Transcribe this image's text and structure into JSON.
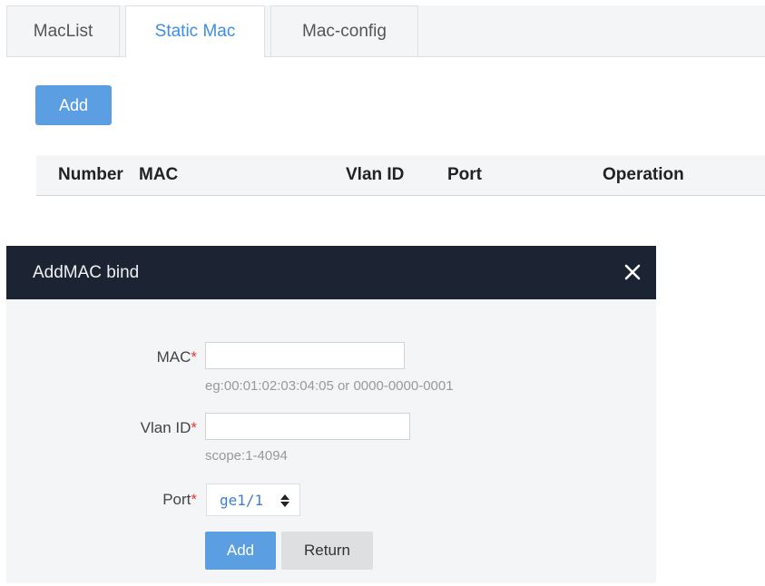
{
  "tabs": [
    {
      "label": "MacList",
      "active": false
    },
    {
      "label": "Static Mac",
      "active": true
    },
    {
      "label": "Mac-config",
      "active": false
    }
  ],
  "toolbar": {
    "add_label": "Add"
  },
  "table": {
    "columns": [
      "Number",
      "MAC",
      "Vlan ID",
      "Port",
      "Operation"
    ]
  },
  "dialog": {
    "title": "AddMAC bind",
    "close_icon": "close-icon",
    "fields": {
      "mac": {
        "label": "MAC",
        "required_mark": "*",
        "value": "",
        "hint": "eg:00:01:02:03:04:05 or 0000-0000-0001"
      },
      "vlan": {
        "label": "Vlan ID",
        "required_mark": "*",
        "value": "",
        "hint": "scope:1-4094"
      },
      "port": {
        "label": "Port",
        "required_mark": "*",
        "selected": "ge1/1"
      }
    },
    "buttons": {
      "add": "Add",
      "return": "Return"
    }
  },
  "colors": {
    "accent": "#5b9ee1",
    "tab_active_text": "#3d8ee3",
    "dialog_header": "#1c2433",
    "required": "#e53935"
  }
}
